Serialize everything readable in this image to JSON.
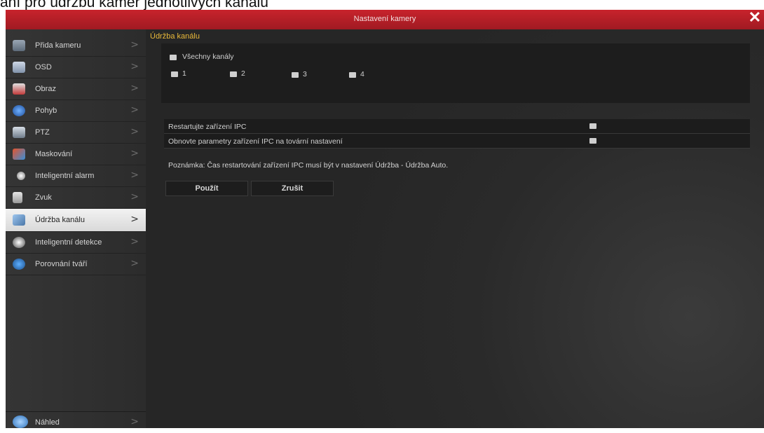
{
  "caption": "ání pro údržbu kamer jednotlivých kanálů",
  "window": {
    "title": "Nastavení kamery",
    "close_glyph": "✕"
  },
  "sidebar": {
    "items": [
      {
        "label": "Přida kameru",
        "icon": "camera-add-icon",
        "active": false
      },
      {
        "label": "OSD",
        "icon": "osd-icon",
        "active": false
      },
      {
        "label": "Obraz",
        "icon": "image-icon",
        "active": false
      },
      {
        "label": "Pohyb",
        "icon": "motion-icon",
        "active": false
      },
      {
        "label": "PTZ",
        "icon": "ptz-camera-icon",
        "active": false
      },
      {
        "label": "Maskování",
        "icon": "mask-icon",
        "active": false
      },
      {
        "label": "Inteligentní alarm",
        "icon": "alarm-icon",
        "active": false
      },
      {
        "label": "Zvuk",
        "icon": "speaker-icon",
        "active": false
      },
      {
        "label": "Údržba kanálu",
        "icon": "wrench-icon",
        "active": true
      },
      {
        "label": "Inteligentní detekce",
        "icon": "detection-icon",
        "active": false
      },
      {
        "label": "Porovnání tváří",
        "icon": "face-compare-icon",
        "active": false
      }
    ],
    "footer": {
      "label": "Náhled",
      "icon": "preview-icon"
    },
    "chevron": ">"
  },
  "main": {
    "section_title": "Údržba kanálu",
    "all_channels_label": "Všechny kanály",
    "channels": [
      "1",
      "2",
      "3",
      "4"
    ],
    "restart_label": "Restartujte zařízení IPC",
    "reset_label": "Obnovte parametry zařízení IPC na tovární nastavení",
    "note": "Poznámka: Čas restartování zařízení IPC musí být v nastavení Údržba - Údržba Auto.",
    "apply_label": "Použít",
    "cancel_label": "Zrušit"
  },
  "colors": {
    "title_bar": "#b81e27",
    "section_title": "#e8b93a",
    "background": "#2a2a2a"
  }
}
